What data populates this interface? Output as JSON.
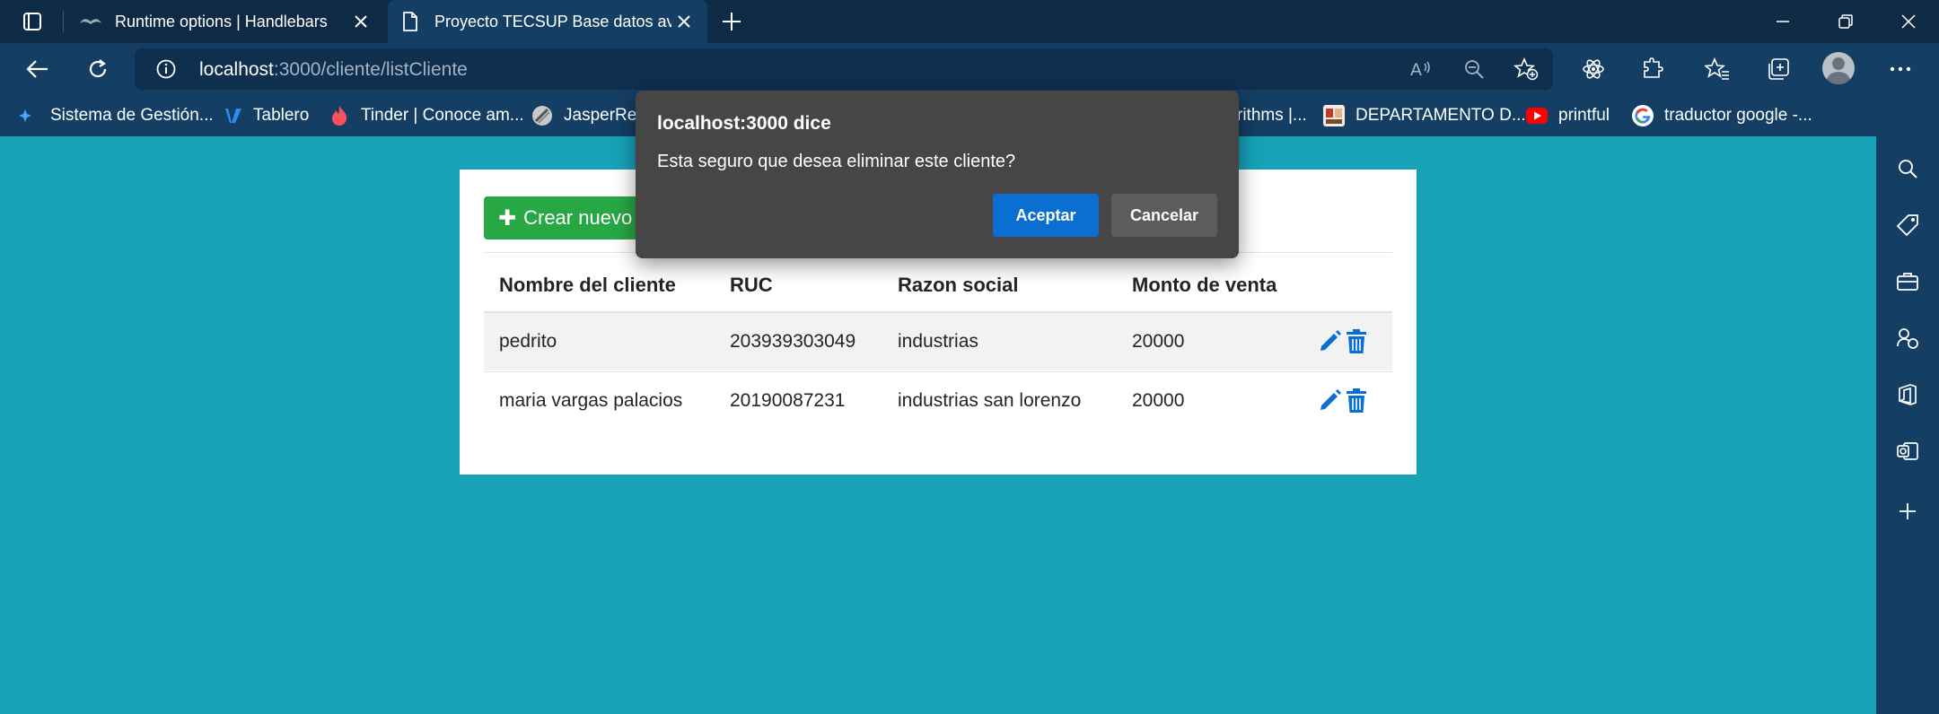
{
  "browser": {
    "tabs": [
      {
        "label": "Runtime options | Handlebars",
        "active": false
      },
      {
        "label": "Proyecto TECSUP Base datos ava",
        "active": true
      }
    ],
    "url_host": "localhost",
    "url_path": ":3000/cliente/listCliente",
    "bookmarks": [
      {
        "label": "Sistema de Gestión...",
        "icon": "sitegestion-icon"
      },
      {
        "label": "Tablero",
        "icon": "tablero-icon"
      },
      {
        "label": "Tinder | Conoce am...",
        "icon": "tinder-icon"
      },
      {
        "label": "JasperRep",
        "icon": "jasper-icon"
      },
      {
        "label": "rithms |...",
        "icon": "page-icon"
      },
      {
        "label": "DEPARTAMENTO D...",
        "icon": "departamento-icon"
      },
      {
        "label": "printful",
        "icon": "youtube-icon"
      },
      {
        "label": "traductor google -...",
        "icon": "google-icon"
      }
    ]
  },
  "page": {
    "create_label": "Crear nuevo c",
    "table": {
      "headers": [
        "Nombre del cliente",
        "RUC",
        "Razon social",
        "Monto de venta"
      ],
      "rows": [
        [
          "pedrito",
          "203939303049",
          "industrias",
          "20000"
        ],
        [
          "maria vargas palacios",
          "20190087231",
          "industrias san lorenzo",
          "20000"
        ]
      ]
    }
  },
  "dialog": {
    "title": "localhost:3000 dice",
    "message": "Esta seguro que desea eliminar este cliente?",
    "ok_label": "Aceptar",
    "cancel_label": "Cancelar"
  },
  "colors": {
    "page_bg": "#17a2b8",
    "browser_chrome": "#143e64",
    "create_button": "#28a745",
    "action_icon": "#0b6fd1",
    "dialog_bg": "#464646",
    "dialog_ok": "#0b6fd1"
  }
}
